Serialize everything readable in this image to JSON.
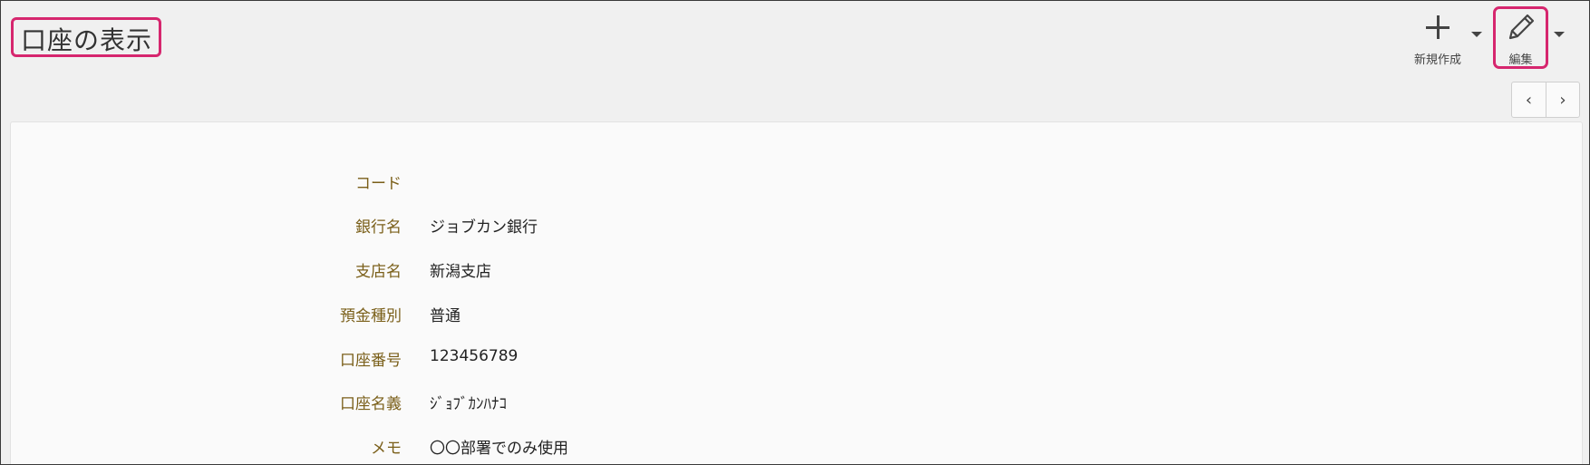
{
  "header": {
    "title": "口座の表示",
    "new_label": "新規作成",
    "edit_label": "編集",
    "pager_prev": "‹",
    "pager_next": "›"
  },
  "fields": [
    {
      "label": "コード",
      "value": ""
    },
    {
      "label": "銀行名",
      "value": "ジョブカン銀行"
    },
    {
      "label": "支店名",
      "value": "新潟支店"
    },
    {
      "label": "預金種別",
      "value": "普通"
    },
    {
      "label": "口座番号",
      "value": "123456789"
    },
    {
      "label": "口座名義",
      "value": "ｼﾞｮﾌﾞｶﾝﾊﾅｺ"
    },
    {
      "label": "メモ",
      "value": "〇〇部署でのみ使用"
    }
  ],
  "colors": {
    "highlight": "#d6266e",
    "label": "#7a5f19"
  }
}
